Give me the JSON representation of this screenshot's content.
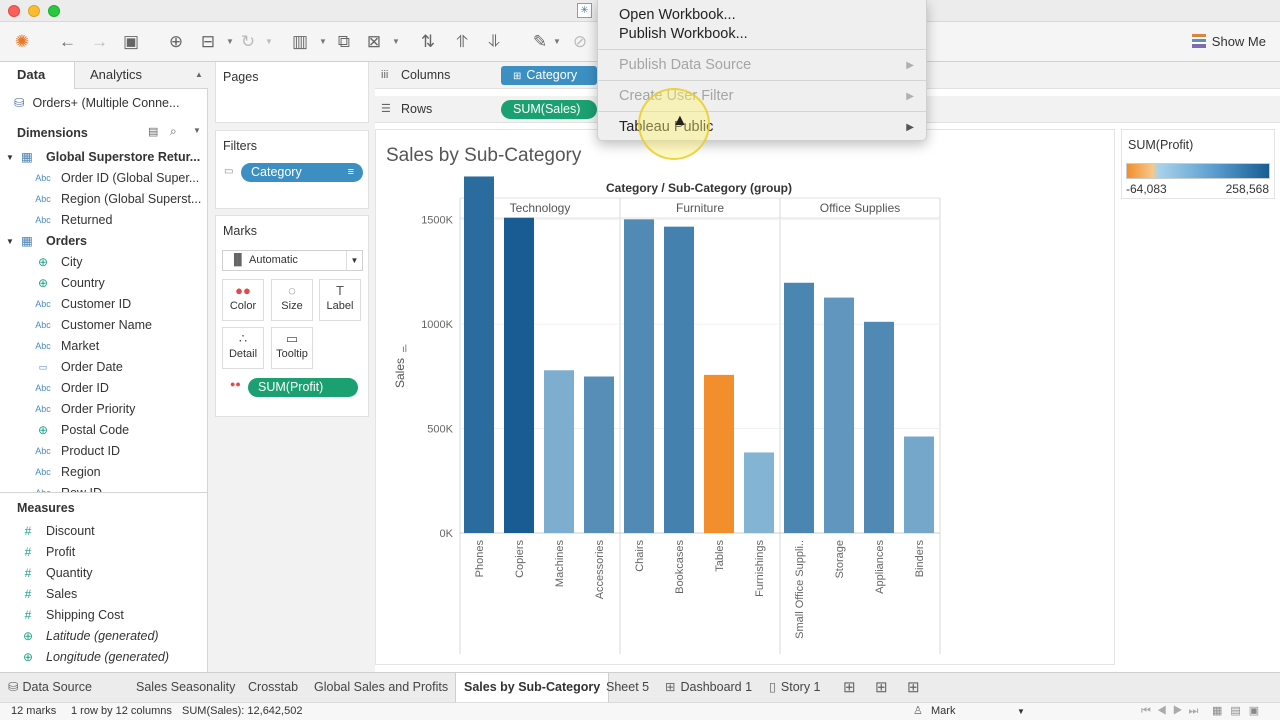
{
  "app": {
    "title_icon": "tableau-logo"
  },
  "toolbar": {
    "show_me_label": "Show Me"
  },
  "left_pane": {
    "tabs": [
      "Data",
      "Analytics"
    ],
    "data_source": "Orders+ (Multiple Conne...",
    "dimensions_label": "Dimensions",
    "dimension_groups": [
      {
        "name": "Global Superstore Retur...",
        "fields": [
          {
            "type": "Abc",
            "name": "Order ID (Global Super..."
          },
          {
            "type": "Abc",
            "name": "Region (Global Superst..."
          },
          {
            "type": "Abc",
            "name": "Returned"
          }
        ]
      },
      {
        "name": "Orders",
        "fields": [
          {
            "type": "geo",
            "name": "City"
          },
          {
            "type": "geo",
            "name": "Country"
          },
          {
            "type": "Abc",
            "name": "Customer ID"
          },
          {
            "type": "Abc",
            "name": "Customer Name"
          },
          {
            "type": "Abc",
            "name": "Market"
          },
          {
            "type": "date",
            "name": "Order Date"
          },
          {
            "type": "Abc",
            "name": "Order ID"
          },
          {
            "type": "Abc",
            "name": "Order Priority"
          },
          {
            "type": "geo",
            "name": "Postal Code"
          },
          {
            "type": "Abc",
            "name": "Product ID"
          },
          {
            "type": "Abc",
            "name": "Region"
          },
          {
            "type": "Abc",
            "name": "Row ID"
          }
        ]
      }
    ],
    "measures_label": "Measures",
    "measures": [
      {
        "type": "#",
        "name": "Discount"
      },
      {
        "type": "#",
        "name": "Profit"
      },
      {
        "type": "#",
        "name": "Quantity"
      },
      {
        "type": "#",
        "name": "Sales"
      },
      {
        "type": "#",
        "name": "Shipping Cost"
      },
      {
        "type": "geo",
        "name": "Latitude (generated)"
      },
      {
        "type": "geo",
        "name": "Longitude (generated)"
      }
    ]
  },
  "cards": {
    "pages_label": "Pages",
    "filters_label": "Filters",
    "filter_pill": "Category",
    "marks_label": "Marks",
    "mark_type": "Automatic",
    "mark_buttons": [
      "Color",
      "Size",
      "Label",
      "Detail",
      "Tooltip"
    ],
    "marks_pill": "SUM(Profit)"
  },
  "shelves": {
    "columns_label": "Columns",
    "columns_pill": "Category",
    "rows_label": "Rows",
    "rows_pill": "SUM(Sales)"
  },
  "sheet": {
    "title": "Sales by Sub-Category"
  },
  "chart_data": {
    "type": "bar",
    "header": "Category / Sub-Category (group)",
    "panes": [
      "Technology",
      "Furniture",
      "Office Supplies"
    ],
    "categories": [
      "Phones",
      "Copiers",
      "Machines",
      "Accessories",
      "Chairs",
      "Bookcases",
      "Tables",
      "Furnishings",
      "Small Office Suppli..",
      "Storage",
      "Appliances",
      "Binders"
    ],
    "pane_index": [
      0,
      0,
      0,
      0,
      1,
      1,
      1,
      1,
      2,
      2,
      2,
      2
    ],
    "values": [
      1706824,
      1509436,
      779060,
      749237,
      1501682,
      1466572,
      757041,
      385578,
      1198000,
      1127086,
      1011064,
      461912
    ],
    "profit": [
      216717,
      258568,
      58868,
      129626,
      140396,
      161925,
      -64083,
      46968,
      150000,
      108461,
      141681,
      72449
    ],
    "ylabel": "Sales",
    "yticks": [
      "0K",
      "500K",
      "1000K",
      "1500K"
    ],
    "ylim": [
      0,
      1900000
    ],
    "color_low": "#f28e2b",
    "color_mid": "#a9d2ea",
    "color_high": "#185c93"
  },
  "legend": {
    "title": "SUM(Profit)",
    "min_label": "-64,083",
    "max_label": "258,568"
  },
  "context_menu": {
    "items": [
      {
        "label": "Open Workbook...",
        "enabled": true,
        "submenu": false
      },
      {
        "label": "Publish Workbook...",
        "enabled": true,
        "submenu": false
      },
      {
        "label": "Publish Data Source",
        "enabled": false,
        "submenu": true
      },
      {
        "label": "Create User Filter",
        "enabled": false,
        "submenu": true
      },
      {
        "label": "Tableau Public",
        "enabled": true,
        "submenu": true
      }
    ]
  },
  "bottom_tabs": {
    "data_source": "Data Source",
    "sheets": [
      "Sales Seasonality",
      "Crosstab",
      "Global Sales and Profits",
      "Sales by Sub-Category",
      "Sheet 5",
      "Dashboard 1",
      "Story 1"
    ],
    "active": "Sales by Sub-Category"
  },
  "status": {
    "marks": "12 marks",
    "layout": "1 row by 12 columns",
    "sum": "SUM(Sales): 12,642,502",
    "selector": "Mark"
  }
}
